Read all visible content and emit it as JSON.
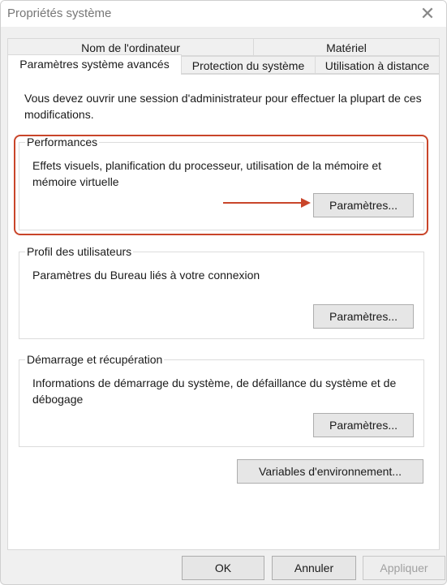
{
  "window": {
    "title": "Propriétés système",
    "close_glyph": "✕"
  },
  "tabs": {
    "row_top": [
      {
        "label": "Nom de l'ordinateur"
      },
      {
        "label": "Matériel"
      }
    ],
    "row_bottom": [
      {
        "label": "Paramètres système avancés",
        "active": true
      },
      {
        "label": "Protection du système"
      },
      {
        "label": "Utilisation à distance"
      }
    ]
  },
  "intro_text": "Vous devez ouvrir une session d'administrateur pour effectuer la plupart de ces modifications.",
  "groups": {
    "performance": {
      "title": "Performances",
      "description": "Effets visuels, planification du processeur, utilisation de la mémoire et mémoire virtuelle",
      "button_label": "Paramètres..."
    },
    "user_profiles": {
      "title": "Profil des utilisateurs",
      "description": "Paramètres du Bureau liés à votre connexion",
      "button_label": "Paramètres..."
    },
    "startup_recovery": {
      "title": "Démarrage et récupération",
      "description": "Informations de démarrage du système, de défaillance du système et de débogage",
      "button_label": "Paramètres..."
    }
  },
  "env_vars_button": "Variables d'environnement...",
  "footer": {
    "ok_label": "OK",
    "cancel_label": "Annuler",
    "apply_label": "Appliquer"
  },
  "colors": {
    "annotation_red": "#c9452a",
    "window_bg": "#f0f0f0",
    "panel_bg": "#ffffff"
  },
  "icons": {
    "close": "close-icon",
    "annotation_arrow": "arrow-right-icon"
  }
}
